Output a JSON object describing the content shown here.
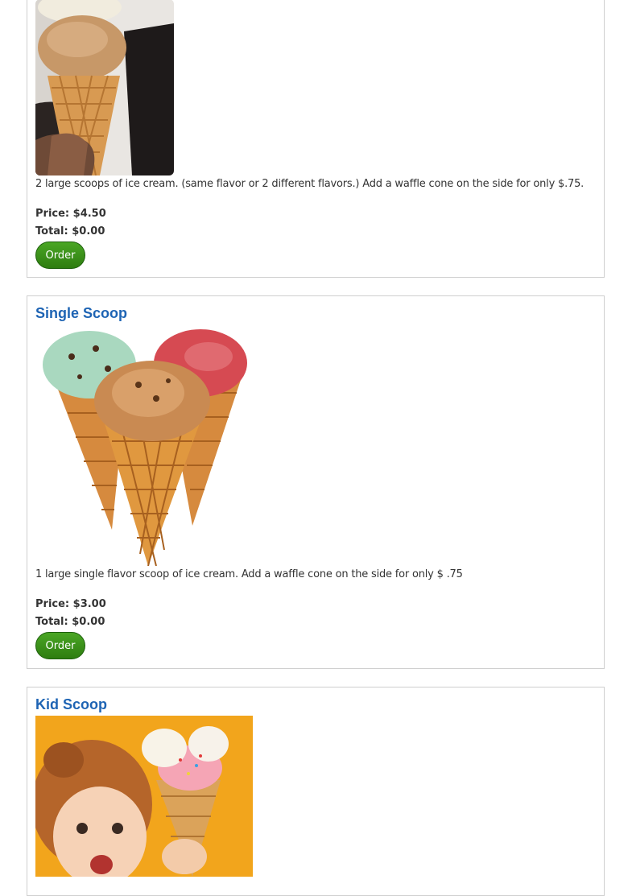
{
  "products": [
    {
      "title": "",
      "image_icon": "double-scoop-cone-photo",
      "description": "2 large scoops of ice cream. (same flavor or 2 different flavors.) Add a waffle cone on the side for only $.75.",
      "price_label": "Price:",
      "price": "$4.50",
      "total_label": "Total:",
      "total": "$0.00",
      "order_label": "Order"
    },
    {
      "title": "Single Scoop",
      "image_icon": "three-waffle-cones-photo",
      "description": "1 large single flavor scoop of ice cream. Add a waffle cone on the side for only $ .75",
      "price_label": "Price:",
      "price": "$3.00",
      "total_label": "Total:",
      "total": "$0.00",
      "order_label": "Order"
    },
    {
      "title": "Kid Scoop",
      "image_icon": "girl-with-cone-photo",
      "description": "",
      "price_label": "",
      "price": "",
      "total_label": "",
      "total": "",
      "order_label": ""
    }
  ],
  "colors": {
    "title": "#1e64b4",
    "button": "#3a8f18",
    "border": "#cfcfcf"
  }
}
